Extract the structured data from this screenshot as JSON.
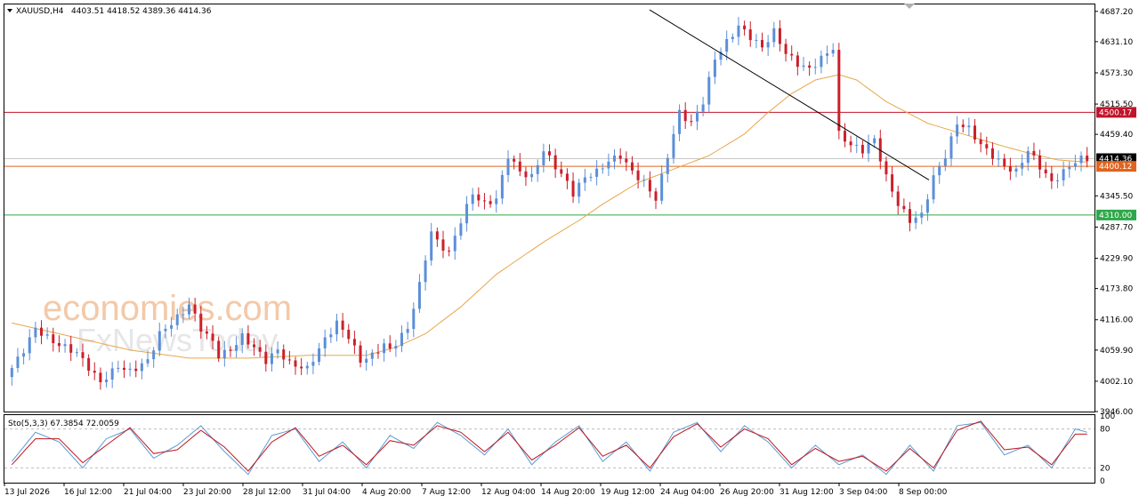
{
  "header": {
    "symbol": "XAUUSD,H4",
    "ohlc": "4403.51 4418.52 4389.36 4414.36",
    "indicator": "Sto(5,3,3) 67.3854 72.0059"
  },
  "watermark": {
    "line1": "economies.com",
    "line2": "FxNewsToday"
  },
  "colors": {
    "bull": "#5b8fd9",
    "bear": "#cc1f2a",
    "ma": "#e8a64a",
    "stoch_main": "#5b9bd5",
    "stoch_signal": "#c0151c"
  },
  "chart_data": {
    "type": "candlestick",
    "title": "XAUUSD,H4",
    "y_ticks": [
      "4687.20",
      "4631.10",
      "4573.30",
      "4515.50",
      "4459.40",
      "4400.12",
      "4345.50",
      "4287.70",
      "4229.90",
      "4173.80",
      "4116.00",
      "4059.90",
      "4002.10",
      "3946.00"
    ],
    "ylim": [
      3946.0,
      4700.0
    ],
    "x_ticks": [
      "13 Jul 2026",
      "16 Jul 12:00",
      "21 Jul 04:00",
      "23 Jul 20:00",
      "28 Jul 12:00",
      "31 Jul 04:00",
      "4 Aug 20:00",
      "7 Aug 12:00",
      "12 Aug 04:00",
      "14 Aug 20:00",
      "19 Aug 12:00",
      "24 Aug 04:00",
      "26 Aug 20:00",
      "31 Aug 12:00",
      "3 Sep 04:00",
      "8 Sep 00:00"
    ],
    "price_levels": [
      {
        "label": "4500.17",
        "value": 4500.17,
        "color": "#c0142a"
      },
      {
        "label": "4414.36",
        "value": 4414.36,
        "color": "#000000"
      },
      {
        "label": "4400.12",
        "value": 4400.12,
        "color": "#e0641e"
      },
      {
        "label": "4310.00",
        "value": 4310.0,
        "color": "#2ea84a"
      }
    ],
    "trendline": {
      "from": {
        "x": "24 Aug 04:00",
        "y": 4690
      },
      "to": {
        "x": "9 Sep 00:00",
        "y": 4375
      }
    },
    "price_path": [
      [
        0,
        4010
      ],
      [
        3,
        4060
      ],
      [
        5,
        4100
      ],
      [
        8,
        4075
      ],
      [
        12,
        4055
      ],
      [
        16,
        4000
      ],
      [
        19,
        4030
      ],
      [
        21,
        4020
      ],
      [
        24,
        4040
      ],
      [
        26,
        4090
      ],
      [
        28,
        4110
      ],
      [
        30,
        4130
      ],
      [
        31,
        4145
      ],
      [
        33,
        4100
      ],
      [
        35,
        4075
      ],
      [
        36,
        4050
      ],
      [
        38,
        4060
      ],
      [
        40,
        4085
      ],
      [
        42,
        4065
      ],
      [
        44,
        4040
      ],
      [
        46,
        4060
      ],
      [
        48,
        4035
      ],
      [
        51,
        4025
      ],
      [
        54,
        4080
      ],
      [
        56,
        4110
      ],
      [
        58,
        4085
      ],
      [
        60,
        4040
      ],
      [
        62,
        4050
      ],
      [
        64,
        4070
      ],
      [
        65,
        4060
      ],
      [
        68,
        4100
      ],
      [
        70,
        4180
      ],
      [
        72,
        4280
      ],
      [
        73,
        4260
      ],
      [
        75,
        4240
      ],
      [
        77,
        4300
      ],
      [
        79,
        4350
      ],
      [
        81,
        4330
      ],
      [
        83,
        4340
      ],
      [
        85,
        4420
      ],
      [
        87,
        4390
      ],
      [
        89,
        4380
      ],
      [
        91,
        4430
      ],
      [
        93,
        4400
      ],
      [
        95,
        4370
      ],
      [
        96,
        4350
      ],
      [
        98,
        4380
      ],
      [
        100,
        4390
      ],
      [
        102,
        4410
      ],
      [
        104,
        4420
      ],
      [
        106,
        4390
      ],
      [
        108,
        4370
      ],
      [
        110,
        4340
      ],
      [
        112,
        4420
      ],
      [
        114,
        4500
      ],
      [
        116,
        4480
      ],
      [
        118,
        4520
      ],
      [
        120,
        4600
      ],
      [
        122,
        4630
      ],
      [
        124,
        4660
      ],
      [
        126,
        4640
      ],
      [
        128,
        4620
      ],
      [
        130,
        4650
      ],
      [
        132,
        4610
      ],
      [
        134,
        4590
      ],
      [
        136,
        4580
      ],
      [
        138,
        4600
      ],
      [
        140,
        4620
      ],
      [
        141,
        4460
      ],
      [
        143,
        4440
      ],
      [
        145,
        4430
      ],
      [
        147,
        4450
      ],
      [
        149,
        4380
      ],
      [
        151,
        4330
      ],
      [
        153,
        4300
      ],
      [
        155,
        4310
      ],
      [
        157,
        4380
      ],
      [
        159,
        4420
      ],
      [
        161,
        4480
      ],
      [
        163,
        4470
      ],
      [
        165,
        4440
      ],
      [
        167,
        4420
      ],
      [
        169,
        4400
      ],
      [
        171,
        4390
      ],
      [
        173,
        4430
      ],
      [
        175,
        4400
      ],
      [
        177,
        4370
      ],
      [
        179,
        4390
      ],
      [
        181,
        4410
      ],
      [
        182,
        4414
      ]
    ],
    "ma_path": [
      [
        0,
        4110
      ],
      [
        10,
        4085
      ],
      [
        20,
        4060
      ],
      [
        30,
        4045
      ],
      [
        40,
        4045
      ],
      [
        50,
        4050
      ],
      [
        60,
        4050
      ],
      [
        65,
        4065
      ],
      [
        70,
        4090
      ],
      [
        76,
        4140
      ],
      [
        82,
        4200
      ],
      [
        90,
        4260
      ],
      [
        96,
        4300
      ],
      [
        100,
        4330
      ],
      [
        106,
        4370
      ],
      [
        112,
        4395
      ],
      [
        118,
        4420
      ],
      [
        124,
        4460
      ],
      [
        128,
        4500
      ],
      [
        132,
        4535
      ],
      [
        136,
        4560
      ],
      [
        140,
        4570
      ],
      [
        143,
        4560
      ],
      [
        148,
        4520
      ],
      [
        155,
        4480
      ],
      [
        161,
        4460
      ],
      [
        167,
        4440
      ],
      [
        172,
        4425
      ],
      [
        177,
        4412
      ],
      [
        182,
        4408
      ]
    ],
    "stoch_range": [
      0,
      100
    ],
    "stoch_levels": [
      20,
      80
    ],
    "stoch_axis_labels": [
      "100",
      "80",
      "20",
      "0"
    ],
    "stoch_main": [
      [
        0,
        30
      ],
      [
        4,
        75
      ],
      [
        8,
        60
      ],
      [
        12,
        20
      ],
      [
        16,
        65
      ],
      [
        20,
        80
      ],
      [
        24,
        35
      ],
      [
        28,
        55
      ],
      [
        32,
        85
      ],
      [
        36,
        45
      ],
      [
        40,
        10
      ],
      [
        44,
        70
      ],
      [
        48,
        80
      ],
      [
        52,
        30
      ],
      [
        56,
        60
      ],
      [
        60,
        20
      ],
      [
        64,
        70
      ],
      [
        68,
        50
      ],
      [
        72,
        90
      ],
      [
        76,
        70
      ],
      [
        80,
        40
      ],
      [
        84,
        80
      ],
      [
        88,
        25
      ],
      [
        92,
        60
      ],
      [
        96,
        85
      ],
      [
        100,
        30
      ],
      [
        104,
        60
      ],
      [
        108,
        15
      ],
      [
        112,
        75
      ],
      [
        116,
        90
      ],
      [
        120,
        45
      ],
      [
        124,
        85
      ],
      [
        128,
        60
      ],
      [
        132,
        20
      ],
      [
        136,
        55
      ],
      [
        140,
        25
      ],
      [
        144,
        40
      ],
      [
        148,
        10
      ],
      [
        152,
        55
      ],
      [
        156,
        15
      ],
      [
        160,
        85
      ],
      [
        164,
        90
      ],
      [
        168,
        40
      ],
      [
        172,
        55
      ],
      [
        176,
        20
      ],
      [
        180,
        80
      ],
      [
        182,
        75
      ]
    ],
    "stoch_signal": [
      [
        0,
        25
      ],
      [
        4,
        65
      ],
      [
        8,
        65
      ],
      [
        12,
        28
      ],
      [
        16,
        55
      ],
      [
        20,
        82
      ],
      [
        24,
        42
      ],
      [
        28,
        48
      ],
      [
        32,
        78
      ],
      [
        36,
        52
      ],
      [
        40,
        15
      ],
      [
        44,
        60
      ],
      [
        48,
        82
      ],
      [
        52,
        38
      ],
      [
        56,
        55
      ],
      [
        60,
        25
      ],
      [
        64,
        62
      ],
      [
        68,
        55
      ],
      [
        72,
        85
      ],
      [
        76,
        75
      ],
      [
        80,
        45
      ],
      [
        84,
        75
      ],
      [
        88,
        32
      ],
      [
        92,
        55
      ],
      [
        96,
        82
      ],
      [
        100,
        38
      ],
      [
        104,
        55
      ],
      [
        108,
        20
      ],
      [
        112,
        68
      ],
      [
        116,
        88
      ],
      [
        120,
        52
      ],
      [
        124,
        80
      ],
      [
        128,
        65
      ],
      [
        132,
        25
      ],
      [
        136,
        50
      ],
      [
        140,
        30
      ],
      [
        144,
        38
      ],
      [
        148,
        15
      ],
      [
        152,
        50
      ],
      [
        156,
        20
      ],
      [
        160,
        78
      ],
      [
        164,
        92
      ],
      [
        168,
        48
      ],
      [
        172,
        52
      ],
      [
        176,
        25
      ],
      [
        180,
        72
      ],
      [
        182,
        72
      ]
    ]
  }
}
